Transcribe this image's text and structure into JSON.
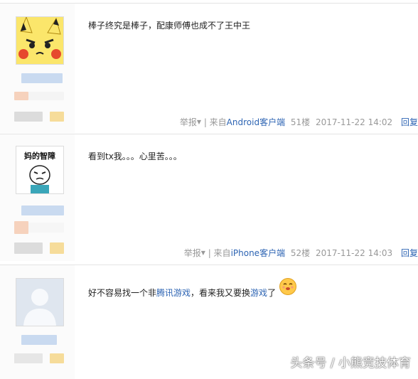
{
  "posts": [
    {
      "content": "棒子终究是棒子，配康师傅也成不了王中王",
      "report": "举报",
      "from_prefix": "| 来自",
      "client": "Android客户端",
      "floor": "51楼",
      "time": "2017-11-22 14:02",
      "reply": "回复"
    },
    {
      "avatar_caption": "妈的智障",
      "content": "看到tx我。。。心里苦。。。",
      "report": "举报",
      "from_prefix": "| 来自",
      "client": "iPhone客户端",
      "floor": "52楼",
      "time": "2017-11-22 14:03",
      "reply": "回复"
    },
    {
      "content_before": "好不容易找一个非",
      "link1": "腾讯游戏",
      "content_mid": "，看来我又要换",
      "link2": "游戏",
      "content_after": "了"
    }
  ],
  "watermark": "头条号 / 小熊竞技体育",
  "colors": {
    "link": "#2d64b3",
    "meta": "#999999",
    "border": "#e4e4e4"
  },
  "icons": [
    "pikachu-avatar",
    "meme-face-avatar",
    "default-user-avatar",
    "smiley-emoji-icon"
  ]
}
